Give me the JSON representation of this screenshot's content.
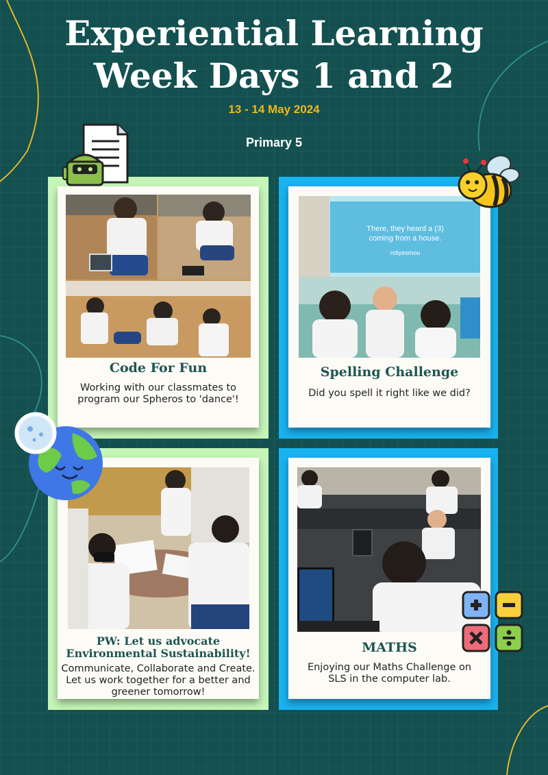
{
  "header": {
    "title_line1": "Experiential Learning",
    "title_line2": "Week Days 1 and 2",
    "dates": "13 - 14 May 2024",
    "level": "Primary 5"
  },
  "colors": {
    "background": "#13504f",
    "accent_yellow": "#f2b61c",
    "panel_green": "#c6f5b8",
    "panel_blue": "#1ab2ef",
    "caption_teal": "#1d5550"
  },
  "cards": [
    {
      "title": "Code For Fun",
      "text_line1": "Working with our classmates to",
      "text_line2": "program our Spheros to 'dance'!"
    },
    {
      "title": "Spelling Challenge",
      "text_line1": "Did you spell it right like we did?",
      "slide_line1": "There, they heard a (3)",
      "slide_line2": "coming from a house.",
      "slide_word": "rstiyesmou"
    },
    {
      "title_line1": "PW: Let us advocate",
      "title_line2": "Environmental Sustainability!",
      "text_line1": "Communicate, Collaborate and Create.",
      "text_line2": "Let us work together for a better and",
      "text_line3": "greener tomorrow!"
    },
    {
      "title": "MATHS",
      "text_line1": "Enjoying our Maths Challenge on",
      "text_line2": "SLS in the computer lab."
    }
  ],
  "icons": [
    "document-robot-icon",
    "bee-icon",
    "earth-icon",
    "math-operators-icon"
  ]
}
